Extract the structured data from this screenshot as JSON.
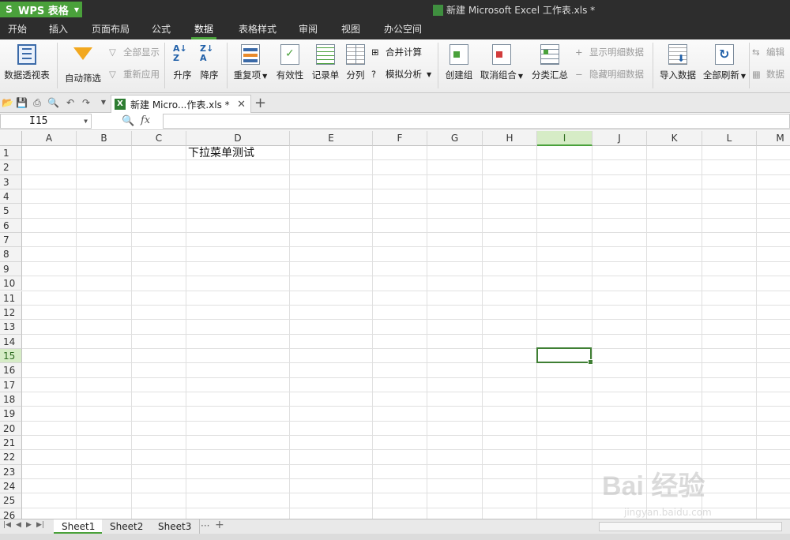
{
  "app": {
    "name": "WPS 表格",
    "window_title": "新建 Microsoft Excel 工作表.xls *"
  },
  "menu": [
    "开始",
    "插入",
    "页面布局",
    "公式",
    "数据",
    "表格样式",
    "审阅",
    "视图",
    "办公空间"
  ],
  "active_menu": "数据",
  "ribbon": {
    "pivot": "数据透视表",
    "autofilter": "自动筛选",
    "show_all": "全部显示",
    "reapply": "重新应用",
    "sort_asc": "升序",
    "sort_desc": "降序",
    "duplicates": "重复项",
    "validity": "有效性",
    "record": "记录单",
    "split": "分列",
    "consolidate": "合并计算",
    "what_if": "模拟分析",
    "group": "创建组",
    "ungroup": "取消组合",
    "subtotal": "分类汇总",
    "show_detail": "显示明细数据",
    "hide_detail": "隐藏明细数据",
    "import": "导入数据",
    "refresh_all": "全部刷新",
    "edit_links": "编辑",
    "data_more": "数据"
  },
  "tab": {
    "doc_label": "新建 Micro...作表.xls *"
  },
  "formula_bar": {
    "name_box": "I15",
    "fx_label": "fx",
    "formula": ""
  },
  "columns": [
    "A",
    "B",
    "C",
    "D",
    "E",
    "F",
    "G",
    "H",
    "I",
    "J",
    "K",
    "L",
    "M"
  ],
  "selected_column": "I",
  "rows": [
    "1",
    "2",
    "3",
    "4",
    "5",
    "6",
    "7",
    "8",
    "9",
    "10",
    "11",
    "12",
    "13",
    "14",
    "15",
    "16",
    "17",
    "18",
    "19",
    "20",
    "21",
    "22",
    "23",
    "24",
    "25",
    "26"
  ],
  "selected_row": "15",
  "cells": {
    "D1": "下拉菜单测试"
  },
  "sheets": [
    "Sheet1",
    "Sheet2",
    "Sheet3"
  ],
  "active_sheet": "Sheet1",
  "sheet_more": "···",
  "watermark": {
    "main": "Bai 经验",
    "url": "jingyan.baidu.com"
  },
  "colors": {
    "accent": "#4aa13b",
    "titlebar": "#2d2d2d",
    "selection": "#3f7f34"
  }
}
